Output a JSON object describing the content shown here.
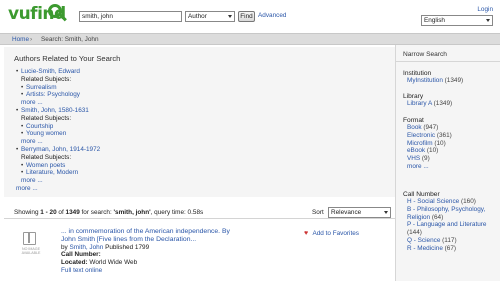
{
  "header": {
    "logo_text": "vufind",
    "search_value": "smith, john",
    "search_type": "Author",
    "find_label": "Find",
    "advanced_label": "Advanced",
    "login_label": "Login",
    "language": "English"
  },
  "breadcrumb": {
    "home": "Home",
    "separator": "›",
    "current": "Search: Smith, John"
  },
  "authors": {
    "heading": "Authors Related to Your Search",
    "entries": [
      {
        "name": "Lucie-Smith, Edward",
        "subjects_label": "Related Subjects:",
        "subjects": [
          "Surrealism",
          "Artists: Psychology"
        ],
        "more": "more ..."
      },
      {
        "name": "Smith, John, 1580-1631",
        "subjects_label": "Related Subjects:",
        "subjects": [
          "Courtship",
          "Young women"
        ],
        "more": "more ..."
      },
      {
        "name": "Berryman, John, 1914-1972",
        "subjects_label": "Related Subjects:",
        "subjects": [
          "Women poets",
          "Literature, Modern"
        ],
        "more": "more ..."
      }
    ],
    "more": "more ..."
  },
  "results": {
    "prefix": "Showing ",
    "range": "1 - 20",
    "of": " of ",
    "total": "1349",
    "for_label": " for search: ",
    "query": "'smith, john'",
    "time": ", query time: 0.58s",
    "sort_label": "Sort",
    "sort_value": "Relevance"
  },
  "record": {
    "title": "... in commemoration of the American independence. By",
    "author_title": "John Smith",
    "subtitle": "[Five lines from the Declaration...",
    "by_label": "by",
    "author": "Smith, John",
    "published": "Published 1799",
    "call_number_label": "Call Number:",
    "located_label": "Located:",
    "located_value": "World Wide Web",
    "full_text": "Full text online",
    "favorites_label": "Add to Favorites",
    "thumb_caption": "NO IMAGE AVAILABLE"
  },
  "sidebar": {
    "heading": "Narrow Search",
    "groups": [
      {
        "title": "Institution",
        "items": [
          {
            "label": "MyInstitution",
            "count": "(1349)"
          }
        ]
      },
      {
        "title": "Library",
        "items": [
          {
            "label": "Library A",
            "count": "(1349)"
          }
        ]
      },
      {
        "title": "Format",
        "items": [
          {
            "label": "Book",
            "count": "(947)"
          },
          {
            "label": "Electronic",
            "count": "(361)"
          },
          {
            "label": "Microfilm",
            "count": "(10)"
          },
          {
            "label": "eBook",
            "count": "(10)"
          },
          {
            "label": "VHS",
            "count": "(9)"
          },
          {
            "label": "more ...",
            "count": ""
          }
        ]
      },
      {
        "title": "Call Number",
        "items": [
          {
            "label": "H - Social Science",
            "count": "(160)"
          },
          {
            "label": "B - Philosophy, Psychology, Religion",
            "count": "(64)"
          },
          {
            "label": "P - Language and Literature",
            "count": "(144)"
          },
          {
            "label": "Q - Science",
            "count": "(117)"
          },
          {
            "label": "R - Medicine",
            "count": "(67)"
          }
        ]
      }
    ]
  }
}
